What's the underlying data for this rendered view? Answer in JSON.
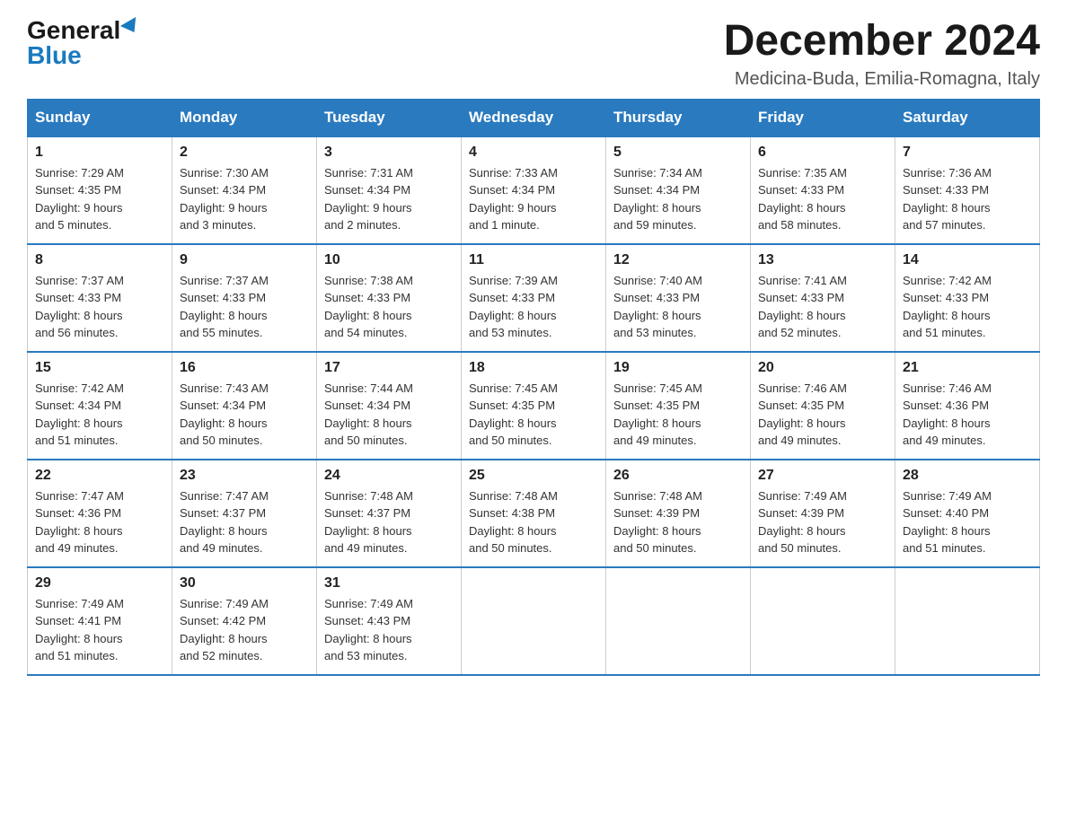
{
  "header": {
    "logo_general": "General",
    "logo_blue": "Blue",
    "title": "December 2024",
    "subtitle": "Medicina-Buda, Emilia-Romagna, Italy"
  },
  "days_of_week": [
    "Sunday",
    "Monday",
    "Tuesday",
    "Wednesday",
    "Thursday",
    "Friday",
    "Saturday"
  ],
  "weeks": [
    [
      {
        "day": "1",
        "sunrise": "7:29 AM",
        "sunset": "4:35 PM",
        "daylight": "9 hours and 5 minutes."
      },
      {
        "day": "2",
        "sunrise": "7:30 AM",
        "sunset": "4:34 PM",
        "daylight": "9 hours and 3 minutes."
      },
      {
        "day": "3",
        "sunrise": "7:31 AM",
        "sunset": "4:34 PM",
        "daylight": "9 hours and 2 minutes."
      },
      {
        "day": "4",
        "sunrise": "7:33 AM",
        "sunset": "4:34 PM",
        "daylight": "9 hours and 1 minute."
      },
      {
        "day": "5",
        "sunrise": "7:34 AM",
        "sunset": "4:34 PM",
        "daylight": "8 hours and 59 minutes."
      },
      {
        "day": "6",
        "sunrise": "7:35 AM",
        "sunset": "4:33 PM",
        "daylight": "8 hours and 58 minutes."
      },
      {
        "day": "7",
        "sunrise": "7:36 AM",
        "sunset": "4:33 PM",
        "daylight": "8 hours and 57 minutes."
      }
    ],
    [
      {
        "day": "8",
        "sunrise": "7:37 AM",
        "sunset": "4:33 PM",
        "daylight": "8 hours and 56 minutes."
      },
      {
        "day": "9",
        "sunrise": "7:37 AM",
        "sunset": "4:33 PM",
        "daylight": "8 hours and 55 minutes."
      },
      {
        "day": "10",
        "sunrise": "7:38 AM",
        "sunset": "4:33 PM",
        "daylight": "8 hours and 54 minutes."
      },
      {
        "day": "11",
        "sunrise": "7:39 AM",
        "sunset": "4:33 PM",
        "daylight": "8 hours and 53 minutes."
      },
      {
        "day": "12",
        "sunrise": "7:40 AM",
        "sunset": "4:33 PM",
        "daylight": "8 hours and 53 minutes."
      },
      {
        "day": "13",
        "sunrise": "7:41 AM",
        "sunset": "4:33 PM",
        "daylight": "8 hours and 52 minutes."
      },
      {
        "day": "14",
        "sunrise": "7:42 AM",
        "sunset": "4:33 PM",
        "daylight": "8 hours and 51 minutes."
      }
    ],
    [
      {
        "day": "15",
        "sunrise": "7:42 AM",
        "sunset": "4:34 PM",
        "daylight": "8 hours and 51 minutes."
      },
      {
        "day": "16",
        "sunrise": "7:43 AM",
        "sunset": "4:34 PM",
        "daylight": "8 hours and 50 minutes."
      },
      {
        "day": "17",
        "sunrise": "7:44 AM",
        "sunset": "4:34 PM",
        "daylight": "8 hours and 50 minutes."
      },
      {
        "day": "18",
        "sunrise": "7:45 AM",
        "sunset": "4:35 PM",
        "daylight": "8 hours and 50 minutes."
      },
      {
        "day": "19",
        "sunrise": "7:45 AM",
        "sunset": "4:35 PM",
        "daylight": "8 hours and 49 minutes."
      },
      {
        "day": "20",
        "sunrise": "7:46 AM",
        "sunset": "4:35 PM",
        "daylight": "8 hours and 49 minutes."
      },
      {
        "day": "21",
        "sunrise": "7:46 AM",
        "sunset": "4:36 PM",
        "daylight": "8 hours and 49 minutes."
      }
    ],
    [
      {
        "day": "22",
        "sunrise": "7:47 AM",
        "sunset": "4:36 PM",
        "daylight": "8 hours and 49 minutes."
      },
      {
        "day": "23",
        "sunrise": "7:47 AM",
        "sunset": "4:37 PM",
        "daylight": "8 hours and 49 minutes."
      },
      {
        "day": "24",
        "sunrise": "7:48 AM",
        "sunset": "4:37 PM",
        "daylight": "8 hours and 49 minutes."
      },
      {
        "day": "25",
        "sunrise": "7:48 AM",
        "sunset": "4:38 PM",
        "daylight": "8 hours and 50 minutes."
      },
      {
        "day": "26",
        "sunrise": "7:48 AM",
        "sunset": "4:39 PM",
        "daylight": "8 hours and 50 minutes."
      },
      {
        "day": "27",
        "sunrise": "7:49 AM",
        "sunset": "4:39 PM",
        "daylight": "8 hours and 50 minutes."
      },
      {
        "day": "28",
        "sunrise": "7:49 AM",
        "sunset": "4:40 PM",
        "daylight": "8 hours and 51 minutes."
      }
    ],
    [
      {
        "day": "29",
        "sunrise": "7:49 AM",
        "sunset": "4:41 PM",
        "daylight": "8 hours and 51 minutes."
      },
      {
        "day": "30",
        "sunrise": "7:49 AM",
        "sunset": "4:42 PM",
        "daylight": "8 hours and 52 minutes."
      },
      {
        "day": "31",
        "sunrise": "7:49 AM",
        "sunset": "4:43 PM",
        "daylight": "8 hours and 53 minutes."
      },
      null,
      null,
      null,
      null
    ]
  ],
  "labels": {
    "sunrise": "Sunrise:",
    "sunset": "Sunset:",
    "daylight": "Daylight:"
  }
}
